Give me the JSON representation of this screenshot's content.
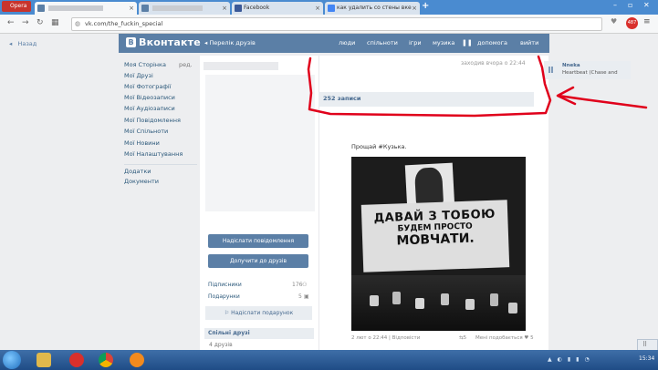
{
  "browser": {
    "opera_label": "Opera",
    "tabs": [
      {
        "label": "",
        "active": true
      },
      {
        "label": ""
      },
      {
        "label": "Facebook"
      },
      {
        "label": "как удалить со стены вке"
      }
    ],
    "new_tab": "+",
    "url": "vk.com/the_fuckin_special",
    "ad_count": "487",
    "back_label": "Назад"
  },
  "vk": {
    "logo_text": "Вконтакте",
    "back_to_friends": "Перелік друзів",
    "nav": [
      "люди",
      "спільноти",
      "ігри",
      "музика",
      "допомога",
      "вийти"
    ],
    "sidebar": [
      "Моя Сторінка",
      "Мої Друзі",
      "Мої Фотографії",
      "Мої Відеозаписи",
      "Мої Аудіозаписи",
      "Мої Повідомлення",
      "Мої Спільноти",
      "Мої Новини",
      "Мої Налаштування"
    ],
    "sidebar_edit": "ред.",
    "sidebar_extra": [
      "Додатки",
      "Документи"
    ],
    "last_seen": "заходив вчора о 22:44",
    "posts_count": "252 записи",
    "send_message": "Надіслати повідомлення",
    "add_friend": "Долучити до друзів",
    "subscriptions_label": "Підписники",
    "subscriptions_value": "176",
    "gifts_label": "Подарунки",
    "gifts_value": "5",
    "view_subscriptions": "Надіслати подарунок",
    "common_friends": "Спільні друзі",
    "friends_count": "4 друзів",
    "post_text": "Прощай #Кузька.",
    "post_footer": "2 лют о 22:44 | Відповісти",
    "post_likes": "Мені подобається ♥ 5",
    "post_reposts": "5",
    "sidecard_name": "Nneka",
    "sidecard_sub": "Heartbeat (Chase and",
    "photo_text_1": "ДАВАЙ З ТОБОЮ",
    "photo_text_2": "БУДЕМ ПРОСТО",
    "photo_text_3": "МОВЧАТИ."
  },
  "taskbar": {
    "clock": "15:34"
  },
  "colors": {
    "vk_blue": "#5b7fa6",
    "annotation_red": "#e0001b",
    "tab_blue": "#4a8bd0"
  }
}
